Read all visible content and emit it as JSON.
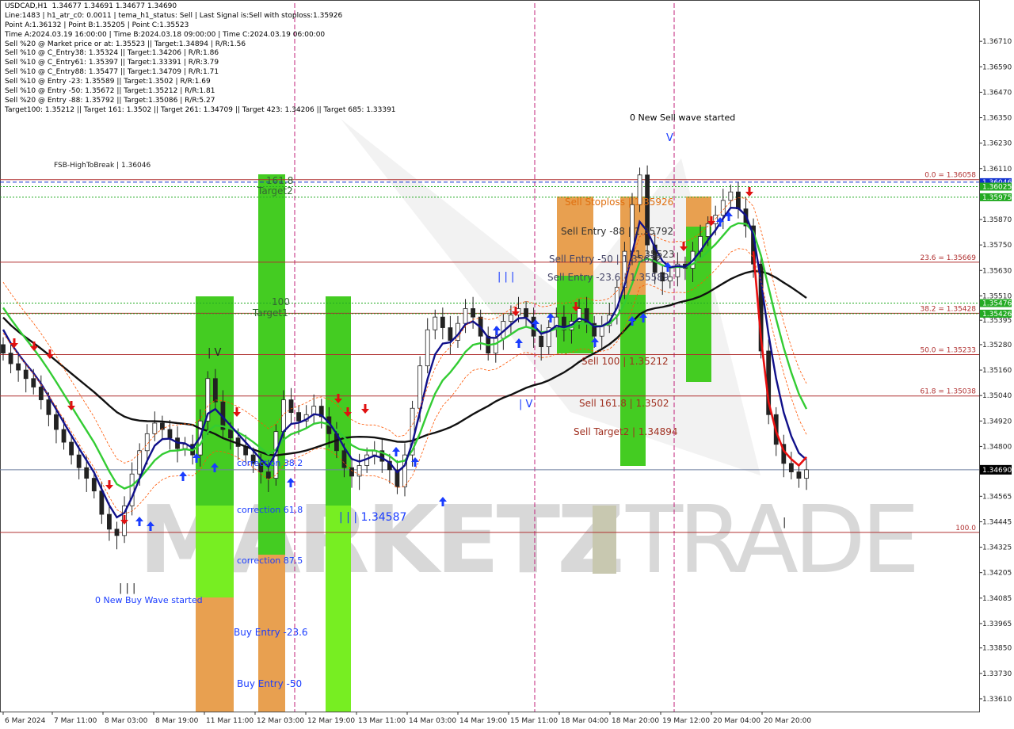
{
  "info_lines": [
    "USDCAD,H1  1.34677 1.34691 1.34677 1.34690",
    "Line:1483 | h1_atr_c0: 0.0011 | tema_h1_status: Sell | Last Signal is:Sell with stoploss:1.35926",
    "Point A:1.36132 | Point B:1.35205 | Point C:1.35523",
    "Time A:2024.03.19 16:00:00 | Time B:2024.03.18 09:00:00 | Time C:2024.03.19 06:00:00",
    "Sell %20 @ Market price or at: 1.35523 || Target:1.34894 | R/R:1.56",
    "Sell %10 @ C_Entry38: 1.35324 || Target:1.34206 | R/R:1.86",
    "Sell %10 @ C_Entry61: 1.35397 || Target:1.33391 | R/R:3.79",
    "Sell %10 @ C_Entry88: 1.35477 || Target:1.34709 | R/R:1.71",
    "Sell %10 @ Entry -23: 1.35589 || Target:1.3502 | R/R:1.69",
    "Sell %10 @ Entry -50: 1.35672 || Target:1.35212 | R/R:1.81",
    "Sell %20 @ Entry -88: 1.35792 || Target:1.35086 | R/R:5.27",
    "Target100: 1.35212 || Target 161: 1.3502 || Target 261: 1.34709 || Target 423: 1.34206 || Target 685: 1.33391"
  ],
  "price_axis": {
    "ticks": [
      "1.36710",
      "1.36590",
      "1.36470",
      "1.36350",
      "1.36230",
      "1.36110",
      "1.35870",
      "1.35750",
      "1.35630",
      "1.35510",
      "1.35395",
      "1.35280",
      "1.35160",
      "1.35040",
      "1.34920",
      "1.34800",
      "1.34565",
      "1.34445",
      "1.34325",
      "1.34205",
      "1.34085",
      "1.33965",
      "1.33850",
      "1.33730",
      "1.33610"
    ],
    "min": 1.3355,
    "max": 1.3689,
    "current": "1.34690",
    "tags": [
      {
        "text": "1.36046",
        "color": "#1030d0"
      },
      {
        "text": "1.36025",
        "color": "#22aa22"
      },
      {
        "text": "1.35975",
        "color": "#22aa22"
      },
      {
        "text": "1.35476",
        "color": "#22aa22"
      },
      {
        "text": "1.35426",
        "color": "#22aa22"
      }
    ]
  },
  "time_axis": [
    "6 Mar 2024",
    "7 Mar 11:00",
    "8 Mar 03:00",
    "8 Mar 19:00",
    "11 Mar 11:00",
    "12 Mar 03:00",
    "12 Mar 19:00",
    "13 Mar 11:00",
    "14 Mar 03:00",
    "14 Mar 19:00",
    "15 Mar 11:00",
    "18 Mar 04:00",
    "18 Mar 20:00",
    "19 Mar 12:00",
    "20 Mar 04:00",
    "20 Mar 20:00"
  ],
  "fib_labels": [
    "0.0 = 1.36058",
    "23.6 = 1.35669",
    "38.2 = 1.35428",
    "50.0 = 1.35233",
    "61.8 = 1.35038",
    "100.0"
  ],
  "annotations": {
    "fsb": "FSB-HighToBreak | 1.36046",
    "new_sell": "0 New Sell wave started",
    "new_buy": "0 New Buy Wave started",
    "sell_stoploss": "Sell Stoploss | 1.35926",
    "sell_entry_88": "Sell Entry -88 | 1.35792",
    "sell_entry_50": "Sell Entry -50 | 1.35672",
    "sell_entry_23": "Sell Entry -23.6 | 1.35589",
    "mid_price": "| 1.35523",
    "sell_100": "Sell 100 | 1.35212",
    "sell_161": "Sell 161.8 | 1.3502",
    "sell_target2": "Sell Target2 | 1.34894",
    "target2_num": "161.8",
    "target2": "Target2",
    "target1_num": "100",
    "target1": "Target1",
    "correction_382": "correction 38.2",
    "correction_618": "correction 61.8",
    "correction_875": "correction 87.5",
    "buy_entry_23": "Buy Entry -23.6",
    "buy_entry_50": "Buy Entry -50",
    "low_level": "| | | 1.34587",
    "wave_iii": "| | |",
    "wave_iv_1": "| V",
    "wave_iv_2": "| V",
    "wave_v": "V",
    "wave_i": "|",
    "wave_iii_low": "| | |"
  },
  "watermark": {
    "left": "MARKETZ",
    "right": "TRADE"
  },
  "colors": {
    "ema_navy": "#10108a",
    "ema_green": "#33cc33",
    "ma_black": "#111111",
    "tema_red": "#e81010",
    "envelope": "#ff5500",
    "sell_zone": "#e8a050",
    "buy_green": "#44cc22",
    "light_green": "#77ee22",
    "fib_line": "#b03030",
    "magenta_vline": "#c0207a",
    "up_arrow": "#1a3cff",
    "down_arrow": "#e01010"
  },
  "chart_data": {
    "type": "candlestick",
    "symbol": "USDCAD",
    "timeframe": "H1",
    "ylim": [
      1.3355,
      1.3689
    ],
    "horizontal_levels": [
      1.36058,
      1.36046,
      1.36025,
      1.35975,
      1.35669,
      1.35476,
      1.35428,
      1.35426,
      1.35233,
      1.35038,
      1.3469,
      1.34395
    ],
    "fib_levels": {
      "0.0": 1.36058,
      "23.6": 1.35669,
      "38.2": 1.35428,
      "50.0": 1.35233,
      "61.8": 1.35038,
      "100.0": 1.34395
    },
    "closes": [
      1.3524,
      1.3519,
      1.3516,
      1.3512,
      1.3508,
      1.3502,
      1.3495,
      1.3488,
      1.3482,
      1.3476,
      1.347,
      1.3465,
      1.3459,
      1.3448,
      1.3441,
      1.3438,
      1.3452,
      1.3467,
      1.3478,
      1.3486,
      1.3491,
      1.3488,
      1.3484,
      1.3479,
      1.3481,
      1.3476,
      1.3492,
      1.3512,
      1.3501,
      1.3488,
      1.3484,
      1.348,
      1.3476,
      1.3472,
      1.3468,
      1.3465,
      1.3487,
      1.3502,
      1.3496,
      1.3492,
      1.3495,
      1.3499,
      1.3494,
      1.3486,
      1.3478,
      1.347,
      1.3466,
      1.3471,
      1.3476,
      1.3478,
      1.3473,
      1.3469,
      1.3461,
      1.3476,
      1.3498,
      1.3518,
      1.3535,
      1.3541,
      1.3536,
      1.353,
      1.3538,
      1.3545,
      1.3541,
      1.3532,
      1.3524,
      1.3531,
      1.3539,
      1.3542,
      1.3545,
      1.3541,
      1.3532,
      1.3527,
      1.3536,
      1.3541,
      1.3535,
      1.3539,
      1.3545,
      1.3538,
      1.3532,
      1.3537,
      1.3542,
      1.3555,
      1.3572,
      1.3594,
      1.3608,
      1.3575,
      1.3562,
      1.3558,
      1.356,
      1.3566,
      1.3564,
      1.3572,
      1.3579,
      1.3585,
      1.3589,
      1.3596,
      1.36,
      1.3592,
      1.3584,
      1.3566,
      1.3525,
      1.3495,
      1.3481,
      1.3472,
      1.3468,
      1.3465,
      1.3469
    ]
  }
}
